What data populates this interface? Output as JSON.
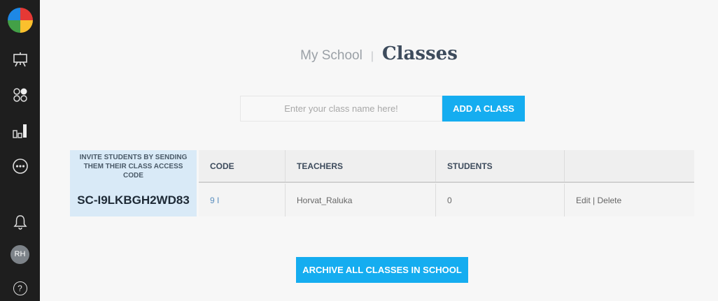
{
  "sidebar": {
    "logo": "logo-icon",
    "items": [
      {
        "name": "classroom",
        "icon": "presentation-board-icon"
      },
      {
        "name": "groups",
        "icon": "circles-grid-icon"
      },
      {
        "name": "reports",
        "icon": "bar-chart-icon"
      },
      {
        "name": "more",
        "icon": "ellipsis-circle-icon"
      },
      {
        "name": "notifications",
        "icon": "bell-icon"
      }
    ],
    "avatar_initials": "RH",
    "help_label": "?"
  },
  "header": {
    "breadcrumb": "My School",
    "separator": "|",
    "title": "Classes"
  },
  "add_class": {
    "placeholder": "Enter your class name here!",
    "value": "",
    "button_label": "ADD A CLASS"
  },
  "invite": {
    "text": "INVITE STUDENTS BY SENDING THEM THEIR CLASS ACCESS CODE",
    "code": "SC-I9LKBGH2WD83"
  },
  "table": {
    "columns": [
      "CODE",
      "TEACHERS",
      "STUDENTS",
      ""
    ],
    "rows": [
      {
        "code": "9 I",
        "teacher": "Horvat_Raluka",
        "students": "0",
        "edit": "Edit",
        "divider": " | ",
        "delete": "Delete"
      }
    ]
  },
  "archive": {
    "button_label": "ARCHIVE ALL CLASSES IN SCHOOL"
  },
  "colors": {
    "accent": "#15adf0",
    "sidebar_bg": "#1e1e1e",
    "invite_bg": "#d9eaf7",
    "link": "#5b8fbf"
  }
}
